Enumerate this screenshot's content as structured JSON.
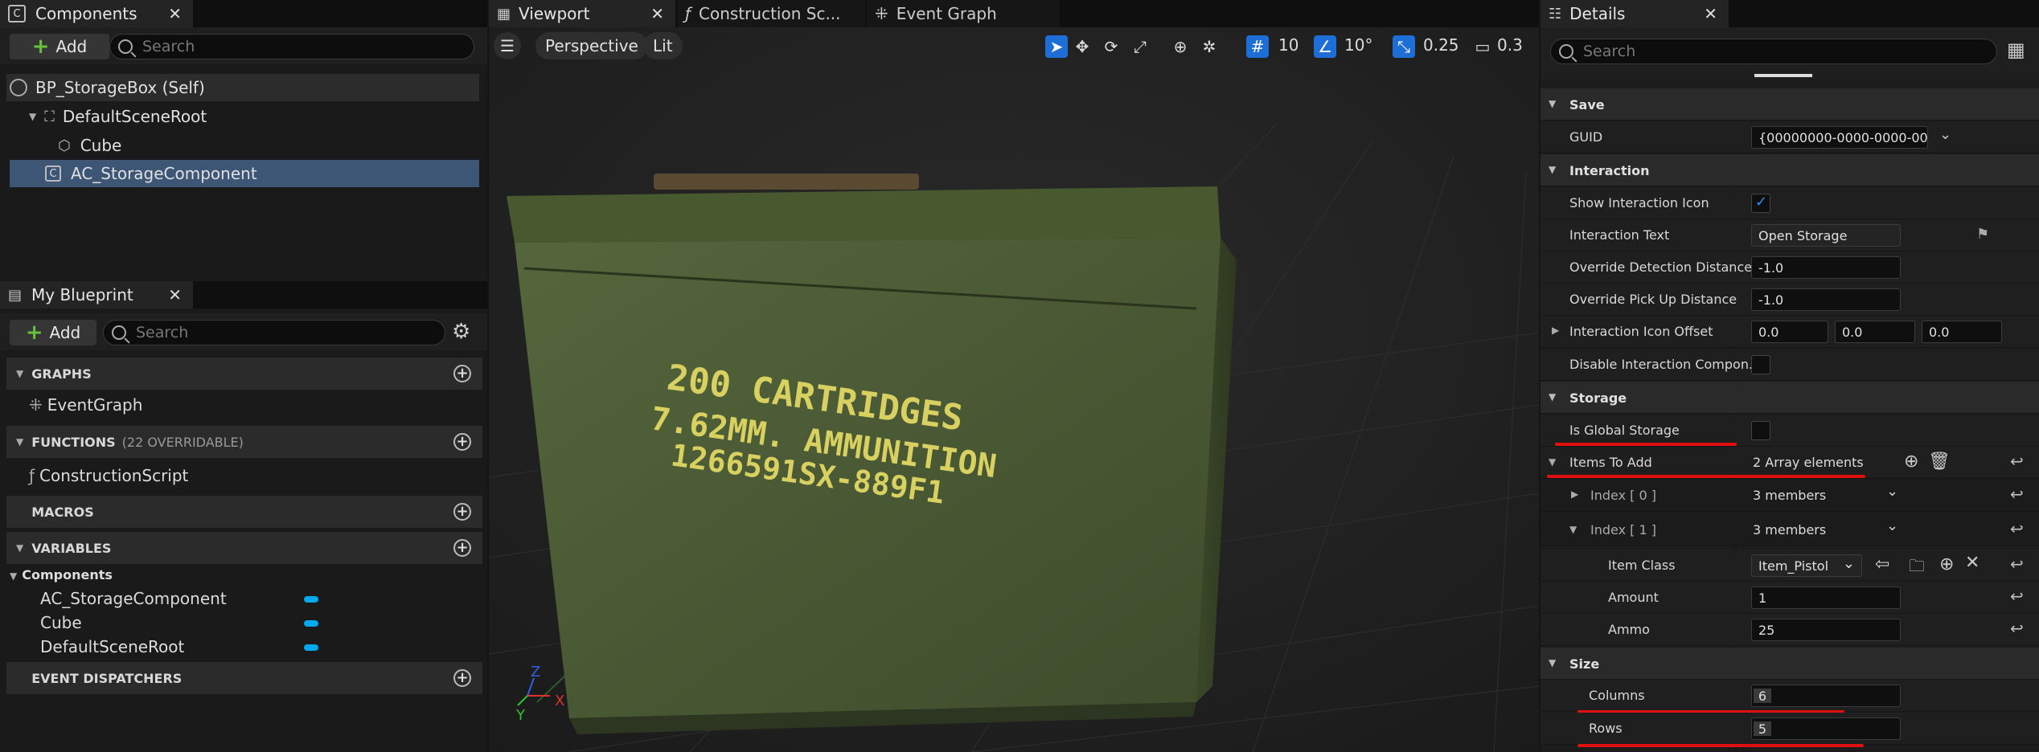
{
  "components_panel": {
    "tab_title": "Components",
    "add_label": "Add",
    "search_placeholder": "Search",
    "tree": [
      "BP_StorageBox (Self)",
      "DefaultSceneRoot",
      "Cube",
      "AC_StorageComponent"
    ]
  },
  "blueprint_panel": {
    "tab_title": "My Blueprint",
    "add_label": "Add",
    "search_placeholder": "Search",
    "sections": {
      "graphs": "GRAPHS",
      "functions": "FUNCTIONS",
      "functions_note": "(22 OVERRIDABLE)",
      "macros": "MACROS",
      "variables": "VARIABLES",
      "event_dispatchers": "EVENT DISPATCHERS"
    },
    "graph_item": "EventGraph",
    "function_item": "ConstructionScript",
    "variables_category": "Components",
    "variables": [
      "AC_StorageComponent",
      "Cube",
      "DefaultSceneRoot"
    ]
  },
  "viewport": {
    "tabs": [
      "Viewport",
      "Construction Sc...",
      "Event Graph"
    ],
    "perspective": "Perspective",
    "lit": "Lit",
    "grid_snap": "10",
    "rotation_snap": "10°",
    "scale_snap": "0.25",
    "camera_speed": "0.3",
    "crate_text": [
      "200 CARTRIDGES",
      "7.62MM. AMMUNITION",
      "1266591SX-889F1"
    ],
    "axis_labels": [
      "Z",
      "Y",
      "X"
    ]
  },
  "details": {
    "tab_title": "Details",
    "search_placeholder": "Search",
    "sections": {
      "save": "Save",
      "interaction": "Interaction",
      "storage": "Storage",
      "size": "Size"
    },
    "guid_label": "GUID",
    "guid_value": "{00000000-0000-0000-0000-00(",
    "show_icon_label": "Show Interaction Icon",
    "interaction_text_label": "Interaction Text",
    "interaction_text_value": "Open Storage",
    "override_detection_label": "Override Detection Distance",
    "override_detection_value": "-1.0",
    "override_pickup_label": "Override Pick Up Distance",
    "override_pickup_value": "-1.0",
    "icon_offset_label": "Interaction Icon Offset",
    "icon_offset_values": [
      "0.0",
      "0.0",
      "0.0"
    ],
    "disable_label": "Disable Interaction Compon...",
    "global_storage_label": "Is Global Storage",
    "items_to_add_label": "Items To Add",
    "items_to_add_value": "2 Array elements",
    "index0_label": "Index [ 0 ]",
    "index0_value": "3 members",
    "index1_label": "Index [ 1 ]",
    "index1_value": "3 members",
    "item_class_label": "Item Class",
    "item_class_value": "Item_Pistol",
    "amount_label": "Amount",
    "amount_value": "1",
    "ammo_label": "Ammo",
    "ammo_value": "25",
    "columns_label": "Columns",
    "columns_value": "6",
    "rows_label": "Rows",
    "rows_value": "5"
  },
  "colors": {
    "accent_blue": "#1e6ed8",
    "annotation_red": "#e01010",
    "crate_green": "#4a5a34",
    "stencil_yellow": "#d8d060"
  }
}
